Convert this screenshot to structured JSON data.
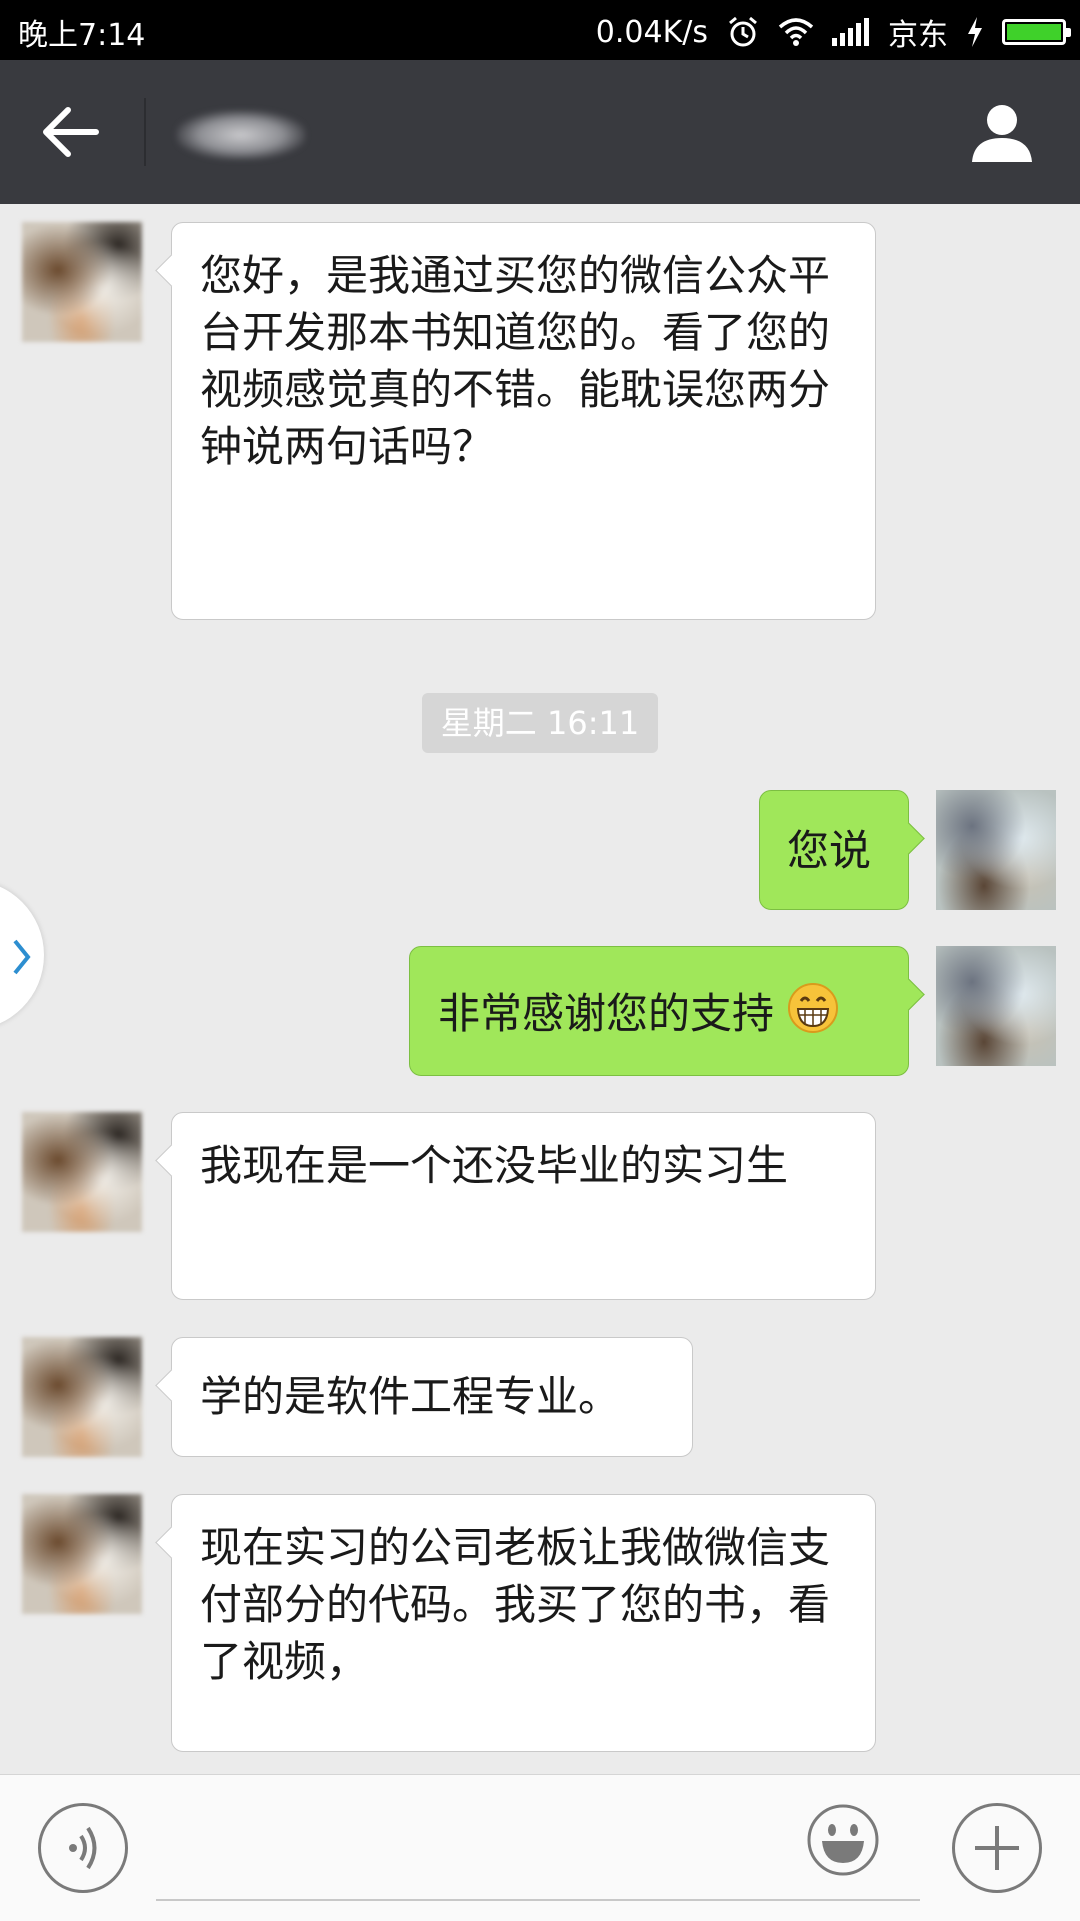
{
  "status_bar": {
    "time": "晚上7:14",
    "speed": "0.04K/s",
    "carrier": "京东",
    "icons": [
      "alarm-icon",
      "wifi-icon",
      "signal-icon",
      "charging-icon",
      "battery-icon"
    ],
    "battery_level": 1.0
  },
  "header": {
    "contact_name": "",
    "back_icon": "back-arrow-icon",
    "profile_icon": "person-icon"
  },
  "messages": [
    {
      "side": "left",
      "text": "您好，是我通过买您的微信公众平台开发那本书知道您的。看了您的视频感觉真的不错。能耽误您两分钟说两句话吗？"
    },
    {
      "side": "right",
      "text": "您说"
    },
    {
      "side": "right",
      "text": "非常感谢您的支持",
      "emoji": "grinning-emoji"
    },
    {
      "side": "left",
      "text": "我现在是一个还没毕业的实习生"
    },
    {
      "side": "left",
      "text": "学的是软件工程专业。"
    },
    {
      "side": "left",
      "text": "现在实习的公司老板让我做微信支付部分的代码。我买了您的书，看了视频，"
    }
  ],
  "timestamp": "星期二 16:11",
  "input_bar": {
    "voice_icon": "voice-icon",
    "emoji_icon": "smiley-icon",
    "plus_icon": "plus-icon",
    "input_value": ""
  },
  "colors": {
    "title_bar": "#393a3f",
    "chat_bg": "#ebebeb",
    "my_bubble": "#a0e75a",
    "other_bubble": "#ffffff"
  }
}
